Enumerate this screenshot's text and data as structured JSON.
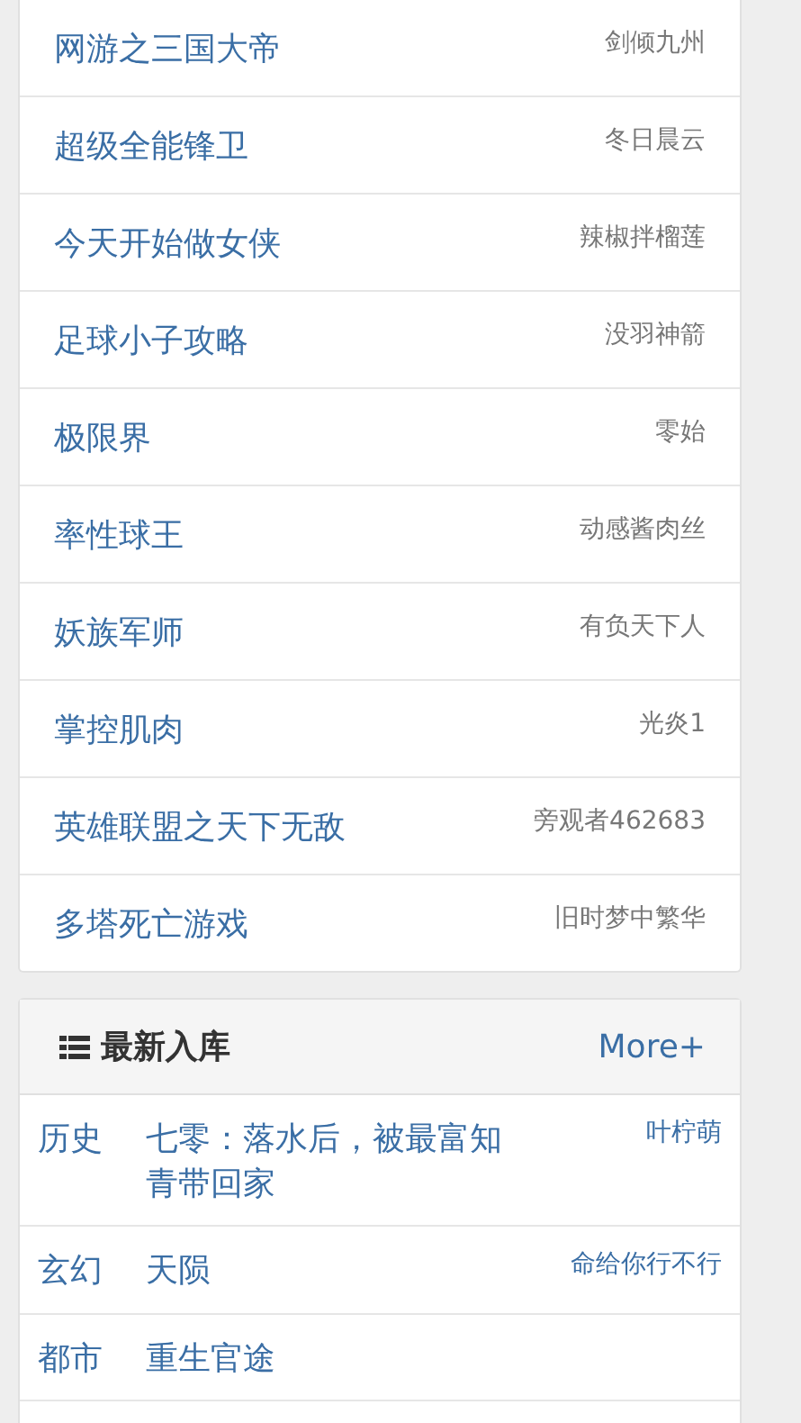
{
  "ranking": [
    {
      "title": "网游之三国大帝",
      "author": "剑倾九州"
    },
    {
      "title": "超级全能锋卫",
      "author": "冬日晨云"
    },
    {
      "title": "今天开始做女侠",
      "author": "辣椒拌榴莲"
    },
    {
      "title": "足球小子攻略",
      "author": "没羽神箭"
    },
    {
      "title": "极限界",
      "author": "零始"
    },
    {
      "title": "率性球王",
      "author": "动感酱肉丝"
    },
    {
      "title": "妖族军师",
      "author": "有负天下人"
    },
    {
      "title": "掌控肌肉",
      "author": "光炎1"
    },
    {
      "title": "英雄联盟之天下无敌",
      "author": "旁观者462683"
    },
    {
      "title": "多塔死亡游戏",
      "author": "旧时梦中繁华"
    }
  ],
  "latest": {
    "heading": "最新入库",
    "more": "More+",
    "rows": [
      {
        "category": "历史",
        "title": "七零：落水后，被最富知青带回家",
        "author": "叶柠萌"
      },
      {
        "category": "玄幻",
        "title": "天陨",
        "author": "命给你行不行"
      },
      {
        "category": "都市",
        "title": "重生官途"
      }
    ]
  }
}
